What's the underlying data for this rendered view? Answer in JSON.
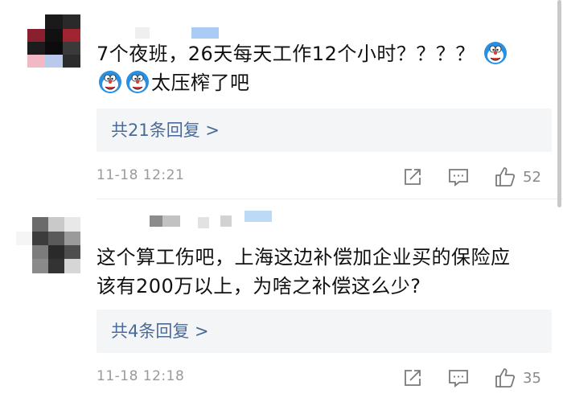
{
  "comments": [
    {
      "text_line1": "7个夜班，26天每天工作12个小时？？？？",
      "text_line2": "太压榨了吧",
      "reply_link": "共21条回复 >",
      "time": "11-18 12:21",
      "likes": "52"
    },
    {
      "text_line1": "这个算工伤吧，上海这边补偿加企业买的保险应",
      "text_line2": "该有200万以上，为啥之补偿这么少?",
      "reply_link": "共4条回复 >",
      "time": "11-18 12:18",
      "likes": "35"
    }
  ],
  "icons": {
    "share": "share-icon",
    "comment": "comment-icon",
    "like": "thumbs-up-icon",
    "emoji": "doraemon-emoji-icon"
  },
  "colors": {
    "reply_link": "#4a6a9a",
    "reply_bg": "#f4f5f7",
    "meta_gray": "#9a9a9a",
    "emoji_blue": "#2b8fe0"
  }
}
